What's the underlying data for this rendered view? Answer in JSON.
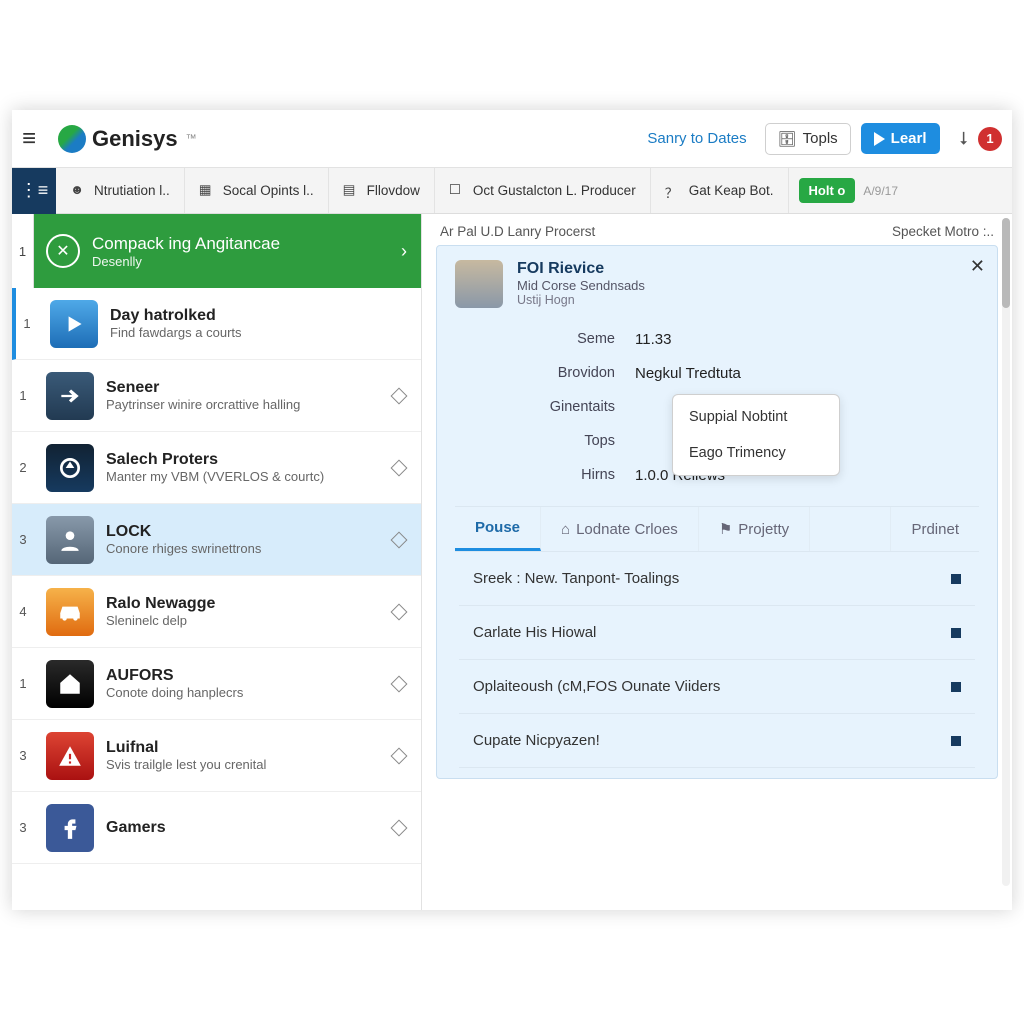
{
  "header": {
    "brand": "Genisys",
    "tm": "™",
    "link": "Sanry to Dates",
    "btn_topls": "Topls",
    "btn_learl": "Learl",
    "notif_count": "1"
  },
  "tabs": {
    "items": [
      "Ntrutiation l..",
      "Socal Opints l..",
      "Fllovdow",
      "Oct Gustalcton L. Producer",
      "Gat Keap Bot."
    ],
    "pill": "Holt o",
    "date": "A/9/17"
  },
  "banner": {
    "num": "1",
    "title": "Compack ing Angitancae",
    "sub": "Desenlly"
  },
  "list": [
    {
      "num": "1",
      "title": "Day hatrolked",
      "sub": "Find fawdargs a courts",
      "icon": "play",
      "active": true
    },
    {
      "num": "1",
      "title": "Seneer",
      "sub": "Paytrinser winire orcrattive halling",
      "icon": "arrow"
    },
    {
      "num": "2",
      "title": "Salech Proters",
      "sub": "Manter my VBM (VVERLOS & courtc)",
      "icon": "circle"
    },
    {
      "num": "3",
      "title": "LOCK",
      "sub": "Conore rhiges swrinettrons",
      "icon": "photo",
      "selected": true
    },
    {
      "num": "4",
      "title": "Ralo Newagge",
      "sub": "Sleninelc delp",
      "icon": "car"
    },
    {
      "num": "1",
      "title": "AUFORS",
      "sub": "Conote doing hanplecrs",
      "icon": "home"
    },
    {
      "num": "3",
      "title": "Luifnal",
      "sub": "Svis trailgle lest you crenital",
      "icon": "warn"
    },
    {
      "num": "3",
      "title": "Gamers",
      "sub": "",
      "icon": "fb"
    }
  ],
  "right": {
    "breadcrumb": "Ar Pal U.D Lanry Procerst",
    "meta": "Specket Motro :.."
  },
  "card": {
    "title": "FOI Rievice",
    "sub1": "Mid Corse Sendnsads",
    "sub2": "Ustij Hogn",
    "rows": {
      "Seme": "11.33",
      "Brovidon": "Negkul Tredtuta",
      "Ginentaits": "",
      "Tops": "",
      "Hirns": "1.0.0 Reliews"
    }
  },
  "popover": [
    "Suppial Nobtint",
    "Eago Trimency"
  ],
  "dtabs": [
    "Pouse",
    "Lodnate Crloes",
    "Projetty",
    "Prdinet"
  ],
  "rows": [
    "Sreek : New. Tanpont- Toalings",
    "Carlate His Hiowal",
    "Oplaiteoush (cM,FOS Ounate Viiders",
    "Cupate Nicpyazen!"
  ]
}
